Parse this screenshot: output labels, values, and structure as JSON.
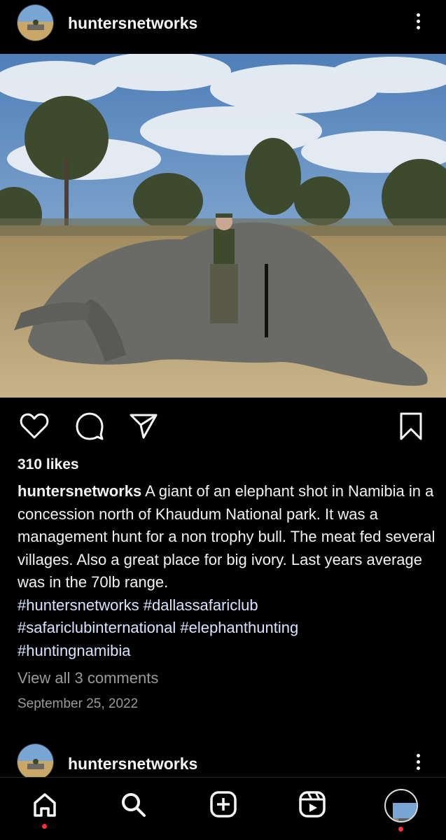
{
  "post": {
    "username": "huntersnetworks",
    "likes": "310 likes",
    "caption_user": "huntersnetworks",
    "caption_text": " A giant of an elephant shot in Namibia in a concession north of Khaudum National park. It was a management hunt for a non trophy bull. The meat fed several villages. Also a great place for big ivory.  Last years average was in the 70lb range.",
    "hashtags": [
      "#huntersnetworks #dallassafariclub",
      "#safariclubinternational #elephanthunting",
      "#huntingnamibia"
    ],
    "comments_link": "View all 3 comments",
    "date": "September 25, 2022"
  },
  "next_post": {
    "username": "huntersnetworks"
  },
  "icons": {
    "like": "heart-icon",
    "comment": "comment-bubble-icon",
    "share": "paper-plane-icon",
    "save": "bookmark-icon",
    "more": "vertical-ellipsis-icon",
    "nav": [
      "home-icon",
      "search-icon",
      "create-post-icon",
      "reels-icon",
      "profile-avatar"
    ]
  },
  "colors": {
    "background": "#000000",
    "text": "#f5f5f5",
    "hashtag": "#d8e4ff",
    "muted": "#9a9a9a",
    "notification_dot": "#ff3040"
  }
}
